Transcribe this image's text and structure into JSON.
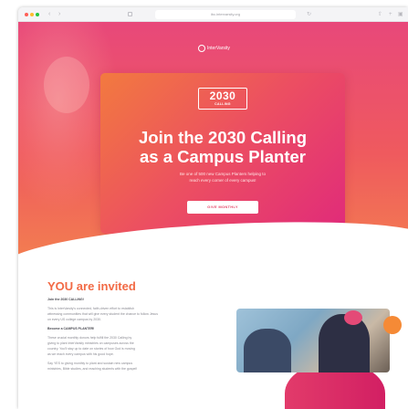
{
  "browser": {
    "url": "ibc.intervarsity.org"
  },
  "logo": {
    "text": "InterVarsity"
  },
  "hero": {
    "badge_year": "2030",
    "badge_sub": "CALLING",
    "title_line1": "Join the 2030 Calling",
    "title_line2": "as a Campus Planter",
    "subtitle_line1": "Be one of 500 new Campus Planters helping to",
    "subtitle_line2": "reach every corner of every campus!",
    "cta_label": "GIVE MONTHLY"
  },
  "invite": {
    "heading": "YOU are invited",
    "lines": [
      "Join the 2030 CALLING!",
      "This is InterVarsity's connected, faith-driven effort to establish",
      "witnessing communities that will give every student the chance to follow Jesus",
      "on every US college campus by 2030.",
      "Become a CAMPUS PLANTER!",
      "These crucial monthly donors help fulfill the 2030 Calling by",
      "giving to plant InterVarsity ministries on campuses across the",
      "country. You'll stay up to date on stories of how God is moving",
      "as we reach every campus with his good hope.",
      "Say YES to giving monthly to plant and sustain new campus",
      "ministries, Bible studies, and reaching students with the gospel!"
    ]
  },
  "colors": {
    "hero_top": "#e8487a",
    "hero_bottom": "#f37e50",
    "heading": "#f26a45",
    "cta_text": "#e6496a"
  }
}
